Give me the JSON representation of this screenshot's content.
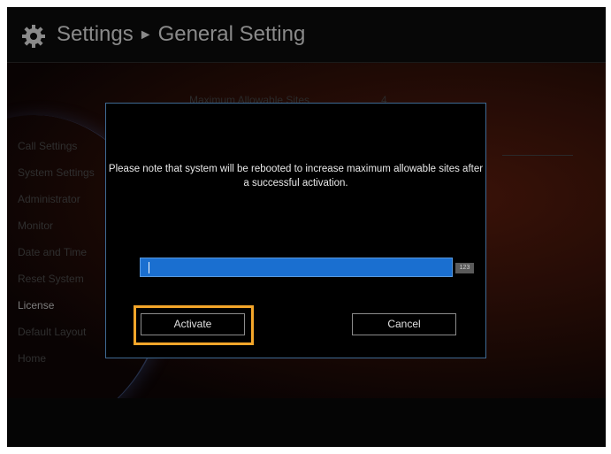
{
  "header": {
    "title": "Settings",
    "separator": "►",
    "subtitle": "General Setting"
  },
  "sidebar": {
    "items": [
      {
        "label": "Call Settings",
        "active": false
      },
      {
        "label": "System Settings",
        "active": false
      },
      {
        "label": "Administrator",
        "active": false
      },
      {
        "label": "Monitor",
        "active": false
      },
      {
        "label": "Date and Time",
        "active": false
      },
      {
        "label": "Reset System",
        "active": false
      },
      {
        "label": "License",
        "active": true
      },
      {
        "label": "Default Layout",
        "active": false
      },
      {
        "label": "Home",
        "active": false
      }
    ]
  },
  "background": {
    "row_label": "Maximum Allowable Sites",
    "row_value": "4"
  },
  "dialog": {
    "message": "Please note that system will be rebooted to increase maximum allowable sites after a successful activation.",
    "input_value": "",
    "input_mode_badge": "123",
    "activate_label": "Activate",
    "cancel_label": "Cancel"
  },
  "colors": {
    "input_fill": "#1a6fd0",
    "dialog_border": "#3f6a93",
    "focus_highlight": "#f4a62a"
  }
}
